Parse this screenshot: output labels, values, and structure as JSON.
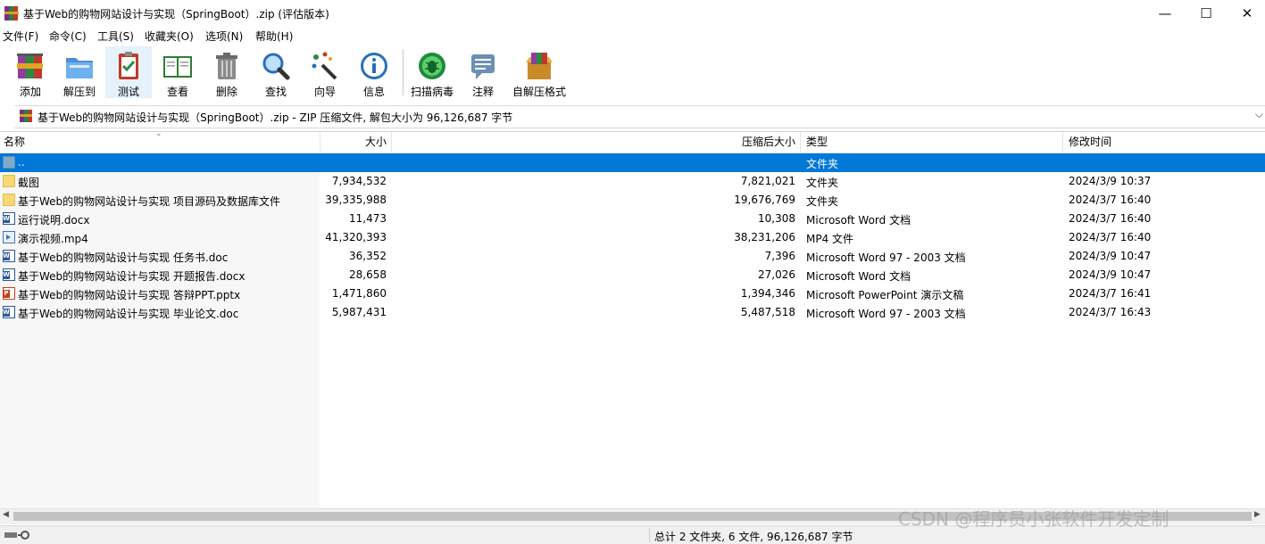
{
  "window": {
    "title": "基于Web的购物网站设计与实现（SpringBoot）.zip (评估版本)",
    "minimize_glyph": "—",
    "maximize_glyph": "☐",
    "close_glyph": "✕"
  },
  "menu": [
    {
      "label": "文件(F)"
    },
    {
      "label": "命令(C)"
    },
    {
      "label": "工具(S)"
    },
    {
      "label": "收藏夹(O)"
    },
    {
      "label": "选项(N)"
    },
    {
      "label": "帮助(H)"
    }
  ],
  "toolbar": [
    {
      "label": "添加",
      "icon": "add-archive-icon"
    },
    {
      "label": "解压到",
      "icon": "extract-to-icon"
    },
    {
      "label": "测试",
      "icon": "test-icon"
    },
    {
      "label": "查看",
      "icon": "view-book-icon"
    },
    {
      "label": "删除",
      "icon": "trash-icon"
    },
    {
      "label": "查找",
      "icon": "magnifier-icon"
    },
    {
      "label": "向导",
      "icon": "wizard-wand-icon"
    },
    {
      "label": "信息",
      "icon": "info-icon"
    },
    {
      "label": "扫描病毒",
      "icon": "virus-scan-icon"
    },
    {
      "label": "注释",
      "icon": "comment-icon"
    },
    {
      "label": "自解压格式",
      "icon": "sfx-icon"
    }
  ],
  "address": {
    "text": "基于Web的购物网站设计与实现（SpringBoot）.zip - ZIP 压缩文件, 解包大小为 96,126,687 字节",
    "dropdown_glyph": "⌵"
  },
  "columns": {
    "name": "名称",
    "size": "大小",
    "packed": "压缩后大小",
    "type": "类型",
    "modified": "修改时间"
  },
  "rows": [
    {
      "name": "..",
      "size": "",
      "packed": "",
      "type": "文件夹",
      "modified": "",
      "icon": "up-folder-icon",
      "selected": true
    },
    {
      "name": "截图",
      "size": "7,934,532",
      "packed": "7,821,021",
      "type": "文件夹",
      "modified": "2024/3/9 10:37",
      "icon": "folder-icon"
    },
    {
      "name": "基于Web的购物网站设计与实现 项目源码及数据库文件",
      "size": "39,335,988",
      "packed": "19,676,769",
      "type": "文件夹",
      "modified": "2024/3/7 16:40",
      "icon": "folder-icon"
    },
    {
      "name": "运行说明.docx",
      "size": "11,473",
      "packed": "10,308",
      "type": "Microsoft Word 文档",
      "modified": "2024/3/7 16:40",
      "icon": "word-doc-icon"
    },
    {
      "name": "演示视频.mp4",
      "size": "41,320,393",
      "packed": "38,231,206",
      "type": "MP4 文件",
      "modified": "2024/3/7 16:40",
      "icon": "video-file-icon"
    },
    {
      "name": "基于Web的购物网站设计与实现 任务书.doc",
      "size": "36,352",
      "packed": "7,396",
      "type": "Microsoft Word 97 - 2003 文档",
      "modified": "2024/3/9 10:47",
      "icon": "word-doc-icon"
    },
    {
      "name": "基于Web的购物网站设计与实现 开题报告.docx",
      "size": "28,658",
      "packed": "27,026",
      "type": "Microsoft Word 文档",
      "modified": "2024/3/9 10:47",
      "icon": "word-doc-icon"
    },
    {
      "name": "基于Web的购物网站设计与实现 答辩PPT.pptx",
      "size": "1,471,860",
      "packed": "1,394,346",
      "type": "Microsoft PowerPoint 演示文稿",
      "modified": "2024/3/7 16:41",
      "icon": "powerpoint-icon"
    },
    {
      "name": "基于Web的购物网站设计与实现 毕业论文.doc",
      "size": "5,987,431",
      "packed": "5,487,518",
      "type": "Microsoft Word 97 - 2003 文档",
      "modified": "2024/3/7 16:43",
      "icon": "word-doc-icon"
    }
  ],
  "status": {
    "text": "总计 2 文件夹, 6 文件, 96,126,687 字节"
  },
  "watermark": "CSDN @程序员小张软件开发定制"
}
